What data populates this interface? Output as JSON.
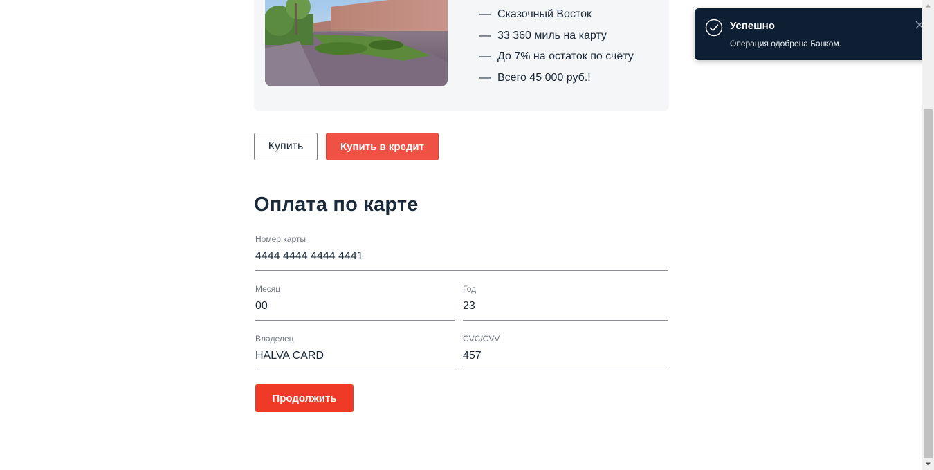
{
  "offer": {
    "features": [
      "Сказочный Восток",
      "33 360 миль на карту",
      "До 7% на остаток по счёту",
      "Всего 45 000 руб.!"
    ],
    "dash": "—"
  },
  "actions": {
    "buy_label": "Купить",
    "buy_credit_label": "Купить в кредит"
  },
  "payment_form": {
    "title": "Оплата по карте",
    "card_number": {
      "label": "Номер карты",
      "value": "4444 4444 4444 4441"
    },
    "month": {
      "label": "Месяц",
      "value": "00"
    },
    "year": {
      "label": "Год",
      "value": "23"
    },
    "owner": {
      "label": "Владелец",
      "value": "HALVA CARD"
    },
    "cvc": {
      "label": "CVC/CVV",
      "value": "457"
    },
    "continue_label": "Продолжить"
  },
  "toast": {
    "title": "Успешно",
    "message": "Операция одобрена Банком.",
    "icon": "check-circle-icon",
    "close_icon": "close-icon"
  },
  "colors": {
    "accent": "#ef5244",
    "continue": "#ee3a27",
    "toast_bg": "#0e1f33",
    "text": "#1b2a3a",
    "card_bg": "#f5f6f8"
  }
}
